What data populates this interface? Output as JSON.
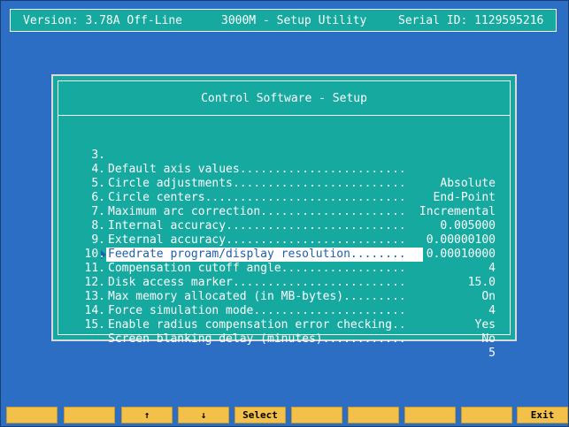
{
  "header": {
    "version": "Version: 3.78A Off-Line",
    "title": "3000M - Setup Utility",
    "serial": "Serial ID: 1129595216"
  },
  "dialog": {
    "title": "Control Software - Setup",
    "items": [
      {
        "num": "3.",
        "label": "Default axis values........................",
        "value": "Absolute"
      },
      {
        "num": "4.",
        "label": "Circle adjustments.........................",
        "value": "End-Point"
      },
      {
        "num": "5.",
        "label": "Circle centers.............................",
        "value": "Incremental"
      },
      {
        "num": "6.",
        "label": "Maximum arc correction.....................",
        "value": "0.005000"
      },
      {
        "num": "7.",
        "label": "Internal accuracy..........................",
        "value": "0.00000100"
      },
      {
        "num": "8.",
        "label": "External accuracy..........................",
        "value": "0.00010000"
      },
      {
        "num": "9.",
        "label": "Feedrate program/display resolution........",
        "value": "4"
      },
      {
        "num": "10.",
        "label": "Compensation cutoff angle..................",
        "value": "15.0"
      },
      {
        "num": "11.",
        "label": "Disk access marker.........................",
        "value": "On"
      },
      {
        "num": "12.",
        "label": "Max memory allocated (in MB-bytes).........",
        "value": "4"
      },
      {
        "num": "13.",
        "label": "Force simulation mode......................",
        "value": "Yes"
      },
      {
        "num": "14.",
        "label": "Enable radius compensation error checking..",
        "value": "No"
      },
      {
        "num": "15.",
        "label": "Screen blanking delay (minutes)............",
        "value": "5"
      }
    ]
  },
  "function_keys": [
    "",
    "",
    "↑",
    "↓",
    "Select",
    "",
    "",
    "",
    "",
    "Exit"
  ]
}
